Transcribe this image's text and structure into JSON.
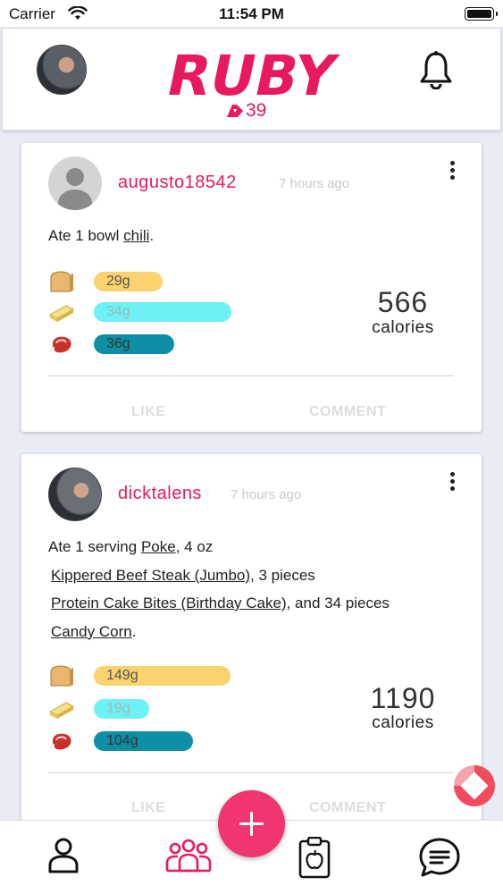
{
  "status_bar": {
    "carrier": "Carrier",
    "time": "11:54 PM"
  },
  "header": {
    "logo_text": "RUBY",
    "points": "39",
    "colors": {
      "brand": "#e8195c"
    }
  },
  "feed": [
    {
      "username": "augusto18542",
      "time_ago": "7 hours ago",
      "desc_prefix": "Ate 1 bowl ",
      "food_links": [
        "chili"
      ],
      "desc_suffix": ".",
      "macros": {
        "carbs": "29g",
        "fat": "34g",
        "protein": "36g"
      },
      "macro_fill": {
        "carbs": 0.38,
        "fat": 1.0,
        "protein": 0.48
      },
      "calories": "566",
      "calories_label": "calories",
      "like_label": "LIKE",
      "comment_label": "COMMENT"
    },
    {
      "username": "dicktalens",
      "time_ago": "7 hours ago",
      "desc_prefix": "Ate 1 serving ",
      "food_links": [
        "Poke",
        "Kippered Beef Steak (Jumbo)",
        "Protein Cake Bites (Birthday Cake)",
        "Candy Corn"
      ],
      "desc_parts": [
        ", 4 oz",
        ", 3 pieces",
        ", and 34 pieces",
        "."
      ],
      "macros": {
        "carbs": "149g",
        "fat": "19g",
        "protein": "104g"
      },
      "macro_fill": {
        "carbs": 0.99,
        "fat": 0.26,
        "protein": 0.65
      },
      "calories": "1190",
      "calories_label": "calories",
      "like_label": "LIKE",
      "comment_label": "COMMENT"
    }
  ],
  "icons": [
    "wifi-icon",
    "battery-icon",
    "user-avatar",
    "bell-icon",
    "kebab-menu-icon",
    "bread-icon",
    "butter-icon",
    "meat-icon",
    "add-icon",
    "profile-icon",
    "friends-icon",
    "food-log-icon",
    "chat-icon",
    "pie-widget-icon"
  ]
}
